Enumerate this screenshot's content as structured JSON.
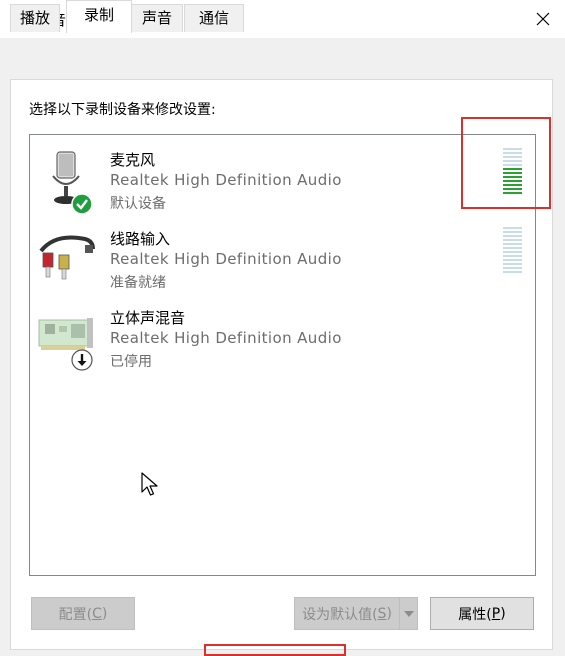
{
  "window": {
    "title": "声音",
    "close_glyph": "✕"
  },
  "tabs": [
    {
      "label": "播放",
      "active": false
    },
    {
      "label": "录制",
      "active": true
    },
    {
      "label": "声音",
      "active": false
    },
    {
      "label": "通信",
      "active": false
    }
  ],
  "recording": {
    "instruction": "选择以下录制设备来修改设置:",
    "devices": [
      {
        "name": "麦克风",
        "driver": "Realtek High Definition Audio",
        "status": "默认设备",
        "icon": "microphone-icon",
        "badge": "default-check-icon",
        "level": 0.6
      },
      {
        "name": "线路输入",
        "driver": "Realtek High Definition Audio",
        "status": "准备就绪",
        "icon": "rca-cable-icon",
        "level": 0
      },
      {
        "name": "立体声混音",
        "driver": "Realtek High Definition Audio",
        "status": "已停用",
        "icon": "sound-card-icon",
        "badge": "disabled-arrow-icon"
      }
    ]
  },
  "buttons": {
    "configure": {
      "text": "配置(",
      "key": "C",
      "end": ")"
    },
    "set_default": {
      "text": "设为默认值(",
      "key": "S",
      "end": ")"
    },
    "properties": {
      "text": "属性(",
      "key": "P",
      "end": ")"
    }
  },
  "colors": {
    "meter_active": "#2aa132",
    "meter_inactive": "#c8dde8",
    "highlight": "#d9322c",
    "check_badge": "#1e9e3e"
  }
}
